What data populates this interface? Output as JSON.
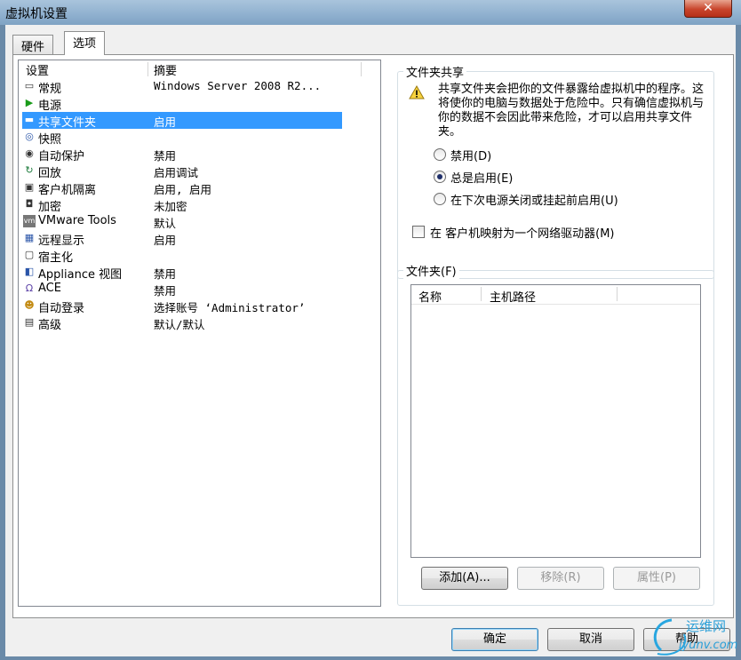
{
  "window": {
    "title": "虚拟机设置",
    "close": "✕"
  },
  "tabs": [
    {
      "label": "硬件",
      "active": false
    },
    {
      "label": "选项",
      "active": true
    }
  ],
  "settings_list": {
    "columns": [
      "设置",
      "摘要"
    ],
    "rows": [
      {
        "icon": "computer-icon",
        "name": "常规",
        "summary": "Windows Server 2008 R2..."
      },
      {
        "icon": "power-icon",
        "name": "电源",
        "summary": ""
      },
      {
        "icon": "folder-icon",
        "name": "共享文件夹",
        "summary": "启用",
        "selected": true
      },
      {
        "icon": "snapshot-icon",
        "name": "快照",
        "summary": ""
      },
      {
        "icon": "autoprotect-icon",
        "name": "自动保护",
        "summary": "禁用"
      },
      {
        "icon": "replay-icon",
        "name": "回放",
        "summary": "启用调试"
      },
      {
        "icon": "lock-icon",
        "name": "客户机隔离",
        "summary": "启用, 启用"
      },
      {
        "icon": "encrypt-icon",
        "name": "加密",
        "summary": "未加密"
      },
      {
        "icon": "vmware-tools-icon",
        "name": "VMware Tools",
        "summary": "默认"
      },
      {
        "icon": "remote-display-icon",
        "name": "远程显示",
        "summary": "启用"
      },
      {
        "icon": "unity-icon",
        "name": "宿主化",
        "summary": ""
      },
      {
        "icon": "appliance-icon",
        "name": "Appliance 视图",
        "summary": "禁用"
      },
      {
        "icon": "ace-icon",
        "name": "ACE",
        "summary": "禁用"
      },
      {
        "icon": "autologon-icon",
        "name": "自动登录",
        "summary": "选择账号 ‘Administrator’"
      },
      {
        "icon": "advanced-icon",
        "name": "高级",
        "summary": "默认/默认"
      }
    ]
  },
  "folder_sharing": {
    "label": "文件夹共享",
    "warning": "共享文件夹会把你的文件暴露给虚拟机中的程序。这将使你的电脑与数据处于危险中。只有确信虚拟机与你的数据不会因此带来危险，才可以启用共享文件夹。",
    "options": [
      {
        "label": "禁用(D)",
        "checked": false
      },
      {
        "label": "总是启用(E)",
        "checked": true
      },
      {
        "label": "在下次电源关闭或挂起前启用(U)",
        "checked": false
      }
    ],
    "map_drive": {
      "label": "在 客户机映射为一个网络驱动器(M)",
      "checked": false
    }
  },
  "folders": {
    "label": "文件夹(F)",
    "columns": [
      "名称",
      "主机路径"
    ],
    "add": "添加(A)...",
    "remove": "移除(R)",
    "properties": "属性(P)"
  },
  "footer": {
    "ok": "确定",
    "cancel": "取消",
    "help": "帮助"
  },
  "watermark": {
    "cn": "运维网",
    "url": "iyunv.com"
  }
}
